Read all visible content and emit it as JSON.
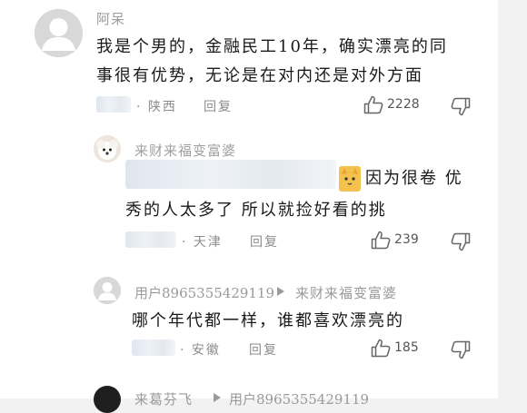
{
  "comments": [
    {
      "username": "阿呆",
      "content_line1": "我是个男的，金融民工10年，确实漂亮的同",
      "content_line2": "事很有优势，无论是在对内还是对外方面",
      "location": "· 陕西",
      "reply_label": "回复",
      "like_count": "2228"
    },
    {
      "username": "来财来福变富婆",
      "content_line1": "因为很卷 优",
      "content_line2": "秀的人太多了 所以就捡好看的挑",
      "location": "· 天津",
      "reply_label": "回复",
      "like_count": "239"
    },
    {
      "username": "用户8965355429119",
      "reply_to": "来财来福变富婆",
      "content_line1": "哪个年代都一样，谁都喜欢漂亮的",
      "location": "· 安徽",
      "reply_label": "回复",
      "like_count": "185"
    },
    {
      "username": "来葛芬飞",
      "reply_to": "用户8965355429119"
    }
  ],
  "icons": {
    "like": "thumbs-up-icon",
    "dislike": "thumbs-down-icon",
    "reply_arrow": "triangle-right-icon"
  },
  "colors": {
    "username": "#9a9a9a",
    "content": "#1a1a1a",
    "meta": "#8c8c8c",
    "background": "#ffffff"
  }
}
